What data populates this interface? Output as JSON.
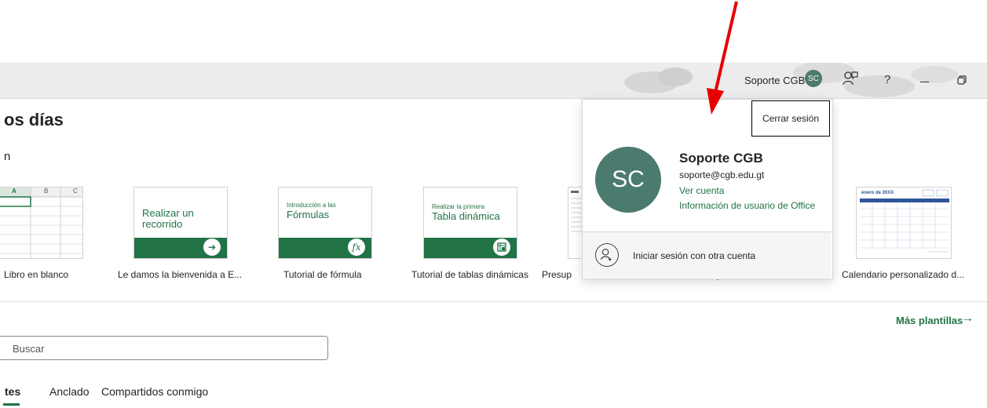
{
  "titlebar": {
    "user_name": "Soporte CGB",
    "user_initials": "SC",
    "help_label": "?"
  },
  "home": {
    "greeting": "os días",
    "section_new": "n"
  },
  "templates": [
    {
      "label": "Libro en blanco"
    },
    {
      "label": "Le damos la bienvenida a E...",
      "tile_text": "Realizar un recorrido"
    },
    {
      "label": "Tutorial de fórmula",
      "tile_small": "Introducción a las",
      "tile_text": "Fórmulas"
    },
    {
      "label": "Tutorial de tablas dinámicas",
      "tile_small": "Realizar la primera",
      "tile_text": "Tabla dinámica"
    },
    {
      "label": "Presup"
    },
    {
      "label": "g"
    },
    {
      "label": "Calendario personalizado d...",
      "tile_small": "enero de 20XX"
    }
  ],
  "blank_columns": [
    "A",
    "B",
    "C"
  ],
  "more_templates": "Más plantillas",
  "search": {
    "placeholder": "Buscar"
  },
  "tabs": [
    "tes",
    "Anclado",
    "Compartidos conmigo"
  ],
  "account_popup": {
    "signout": "Cerrar sesión",
    "initials": "SC",
    "name": "Soporte CGB",
    "email": "soporte@cgb.edu.gt",
    "view_account": "Ver cuenta",
    "office_info": "Información de usuario de Office",
    "other_account": "Iniciar sesión con otra cuenta"
  },
  "colors": {
    "accent": "#217346",
    "avatar": "#4b7a6e",
    "annotation": "#e60000"
  }
}
